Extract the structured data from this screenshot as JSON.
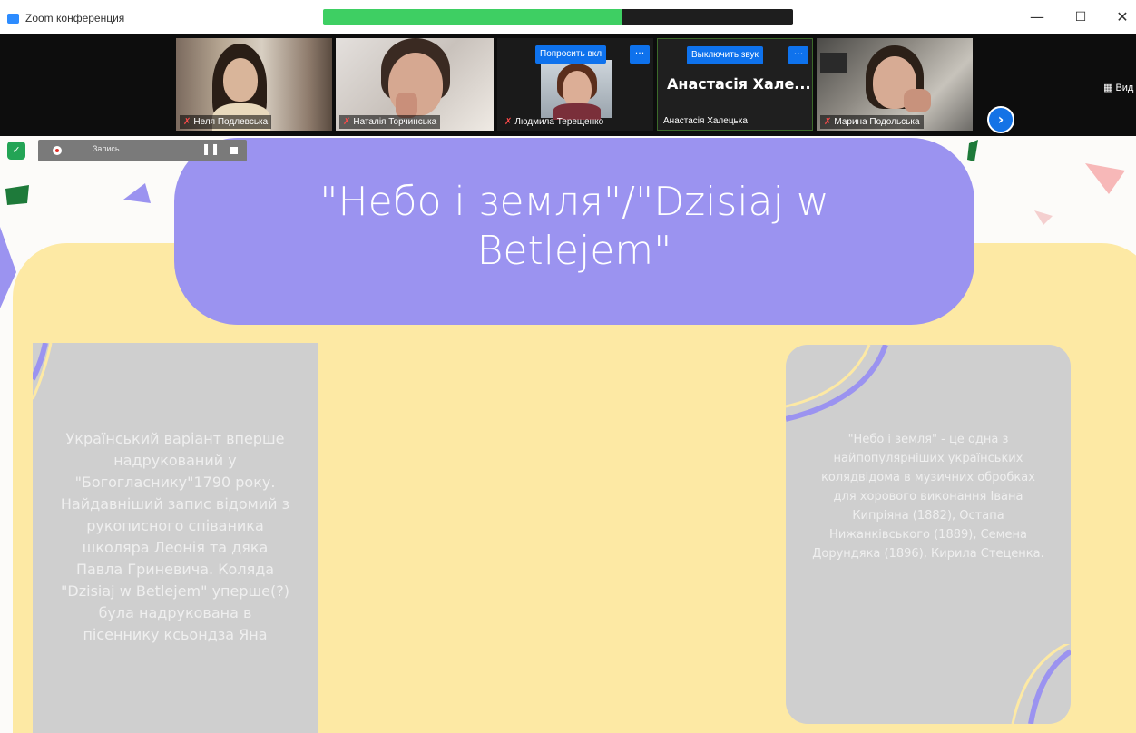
{
  "window": {
    "title": "Zoom конференция",
    "minimize_glyph": "—",
    "maximize_glyph": "☐",
    "close_glyph": "✕"
  },
  "participants": [
    {
      "name": "Неля Подлевська",
      "muted": true
    },
    {
      "name": "Наталія Торчинська",
      "muted": true
    },
    {
      "name": "Людмила Терещенко",
      "muted": true,
      "action_button": "Попросить вкл",
      "more": "···"
    },
    {
      "name": "Анастасія Халецька",
      "muted": false,
      "display_name": "Анастасія Хале...",
      "action_button": "Выключить звук",
      "more": "···"
    },
    {
      "name": "Марина Подольська",
      "muted": true
    }
  ],
  "strip": {
    "view_label": "Вид"
  },
  "recording": {
    "label": "Запись...",
    "pause_glyph": "❚❚"
  },
  "slide": {
    "title": "\"Небо і земля\"/\"Dzisiaj w Betlejem\"",
    "left_text": "Український варіант вперше надрукований у \"Богогласнику\"1790 року. Найдавніший запис відомий з рукописного співаника школяра Леонія та дяка Павла Гриневича. Коляда \"Dzisiaj w Betlejem\" уперше(?) була надрукована в пісеннику ксьондза Яна",
    "right_text": "\"Небо і земля\" - це одна з найпопулярніших українських колядвідома в музичних обробках для хорового виконання Івана Кипріяна (1882), Остапа Нижанківського (1889), Семена Дорундяка (1896), Кирила Стеценка."
  },
  "colors": {
    "title_pill": "#9b93f0",
    "yellow_panel": "#fde9a4",
    "card": "#cfcfcf",
    "zoom_blue": "#0e72ed"
  },
  "icons": {
    "app": "zoom-logo-icon",
    "shield": "shield-icon",
    "next": "chevron-right-icon",
    "mic": "mic-muted-icon"
  }
}
